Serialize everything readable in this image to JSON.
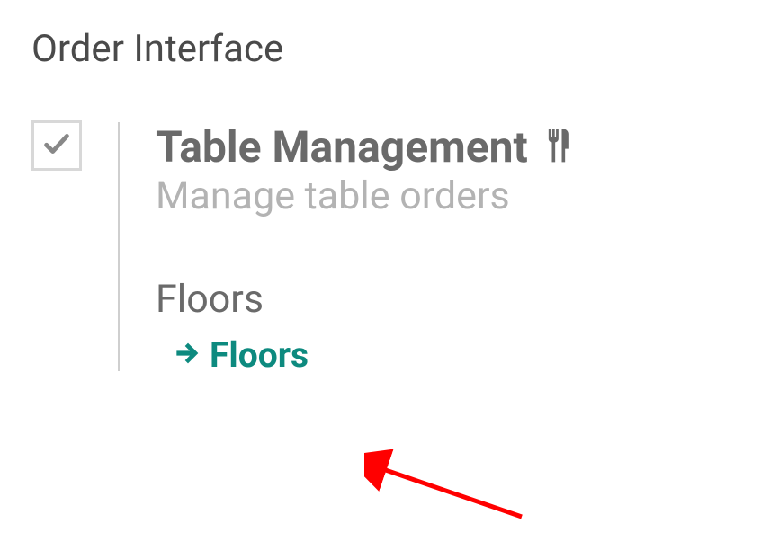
{
  "section": {
    "title": "Order Interface"
  },
  "setting": {
    "checked": true,
    "title": "Table Management",
    "description": "Manage table orders",
    "sub_label": "Floors",
    "link_label": "Floors"
  },
  "colors": {
    "accent": "#0d8a7f",
    "text_primary": "#6a6a6a",
    "text_muted": "#b3b3b3"
  }
}
